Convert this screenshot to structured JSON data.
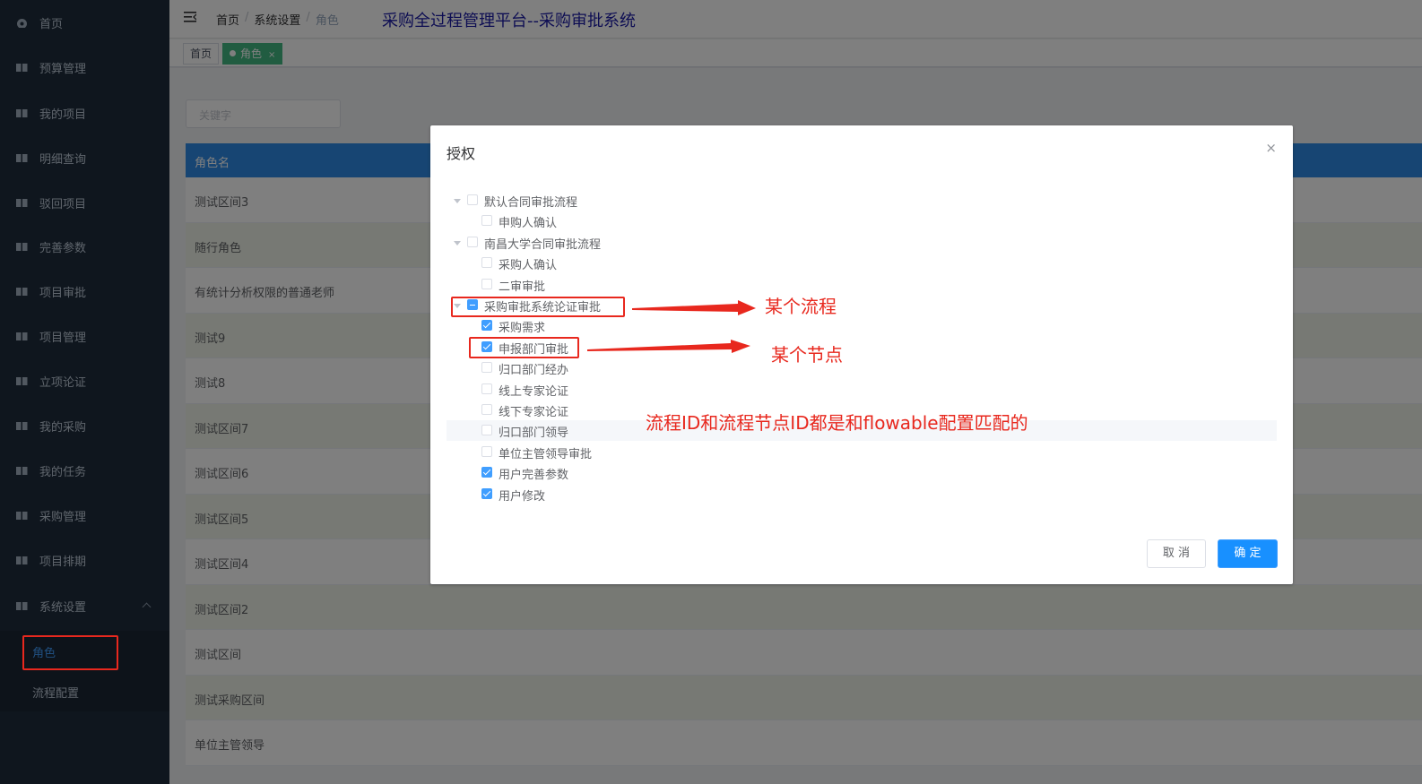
{
  "sidebar": {
    "items": [
      {
        "label": "首页",
        "icon": "dashboard-icon"
      },
      {
        "label": "预算管理",
        "icon": "book-icon"
      },
      {
        "label": "我的项目",
        "icon": "book-icon"
      },
      {
        "label": "明细查询",
        "icon": "book-icon"
      },
      {
        "label": "驳回项目",
        "icon": "book-icon"
      },
      {
        "label": "完善参数",
        "icon": "book-icon"
      },
      {
        "label": "项目审批",
        "icon": "book-icon"
      },
      {
        "label": "项目管理",
        "icon": "book-icon"
      },
      {
        "label": "立项论证",
        "icon": "book-icon"
      },
      {
        "label": "我的采购",
        "icon": "book-icon"
      },
      {
        "label": "我的任务",
        "icon": "book-icon"
      },
      {
        "label": "采购管理",
        "icon": "book-icon"
      },
      {
        "label": "项目排期",
        "icon": "book-icon"
      },
      {
        "label": "系统设置",
        "icon": "book-icon"
      }
    ],
    "submenu": [
      {
        "label": "角色",
        "active": true
      },
      {
        "label": "流程配置",
        "active": false
      }
    ]
  },
  "navbar": {
    "breadcrumb": [
      "首页",
      "系统设置",
      "角色"
    ],
    "separator": "/",
    "platform_title": "采购全过程管理平台--采购审批系统"
  },
  "tags": [
    {
      "label": "首页",
      "active": false
    },
    {
      "label": "角色",
      "active": true,
      "close": "×"
    }
  ],
  "search": {
    "placeholder": "关键字"
  },
  "table": {
    "header": "角色名",
    "rows": [
      "测试区间3",
      "随行角色",
      "有统计分析权限的普通老师",
      "测试9",
      "测试8",
      "测试区间7",
      "测试区间6",
      "测试区间5",
      "测试区间4",
      "测试区间2",
      "测试区间",
      "测试采购区间",
      "单位主管领导"
    ]
  },
  "dialog": {
    "title": "授权",
    "close": "×",
    "tree": [
      {
        "label": "默认合同审批流程",
        "level": 0,
        "state": "unchecked",
        "expanded": true
      },
      {
        "label": "申购人确认",
        "level": 1,
        "state": "unchecked"
      },
      {
        "label": "南昌大学合同审批流程",
        "level": 0,
        "state": "unchecked",
        "expanded": true
      },
      {
        "label": "采购人确认",
        "level": 1,
        "state": "unchecked"
      },
      {
        "label": "二审审批",
        "level": 1,
        "state": "unchecked"
      },
      {
        "label": "采购审批系统论证审批",
        "level": 0,
        "state": "indeterminate",
        "expanded": true
      },
      {
        "label": "采购需求",
        "level": 1,
        "state": "checked"
      },
      {
        "label": "申报部门审批",
        "level": 1,
        "state": "checked"
      },
      {
        "label": "归口部门经办",
        "level": 1,
        "state": "unchecked"
      },
      {
        "label": "线上专家论证",
        "level": 1,
        "state": "unchecked"
      },
      {
        "label": "线下专家论证",
        "level": 1,
        "state": "unchecked"
      },
      {
        "label": "归口部门领导",
        "level": 1,
        "state": "unchecked",
        "hover": true
      },
      {
        "label": "单位主管领导审批",
        "level": 1,
        "state": "unchecked"
      },
      {
        "label": "用户完善参数",
        "level": 1,
        "state": "checked"
      },
      {
        "label": "用户修改",
        "level": 1,
        "state": "checked"
      }
    ],
    "cancel_label": "取 消",
    "confirm_label": "确 定"
  },
  "annotations": {
    "flow_label": "某个流程",
    "node_label": "某个节点",
    "note": "流程ID和流程节点ID都是和flowable配置匹配的",
    "color": "#e8281e"
  }
}
